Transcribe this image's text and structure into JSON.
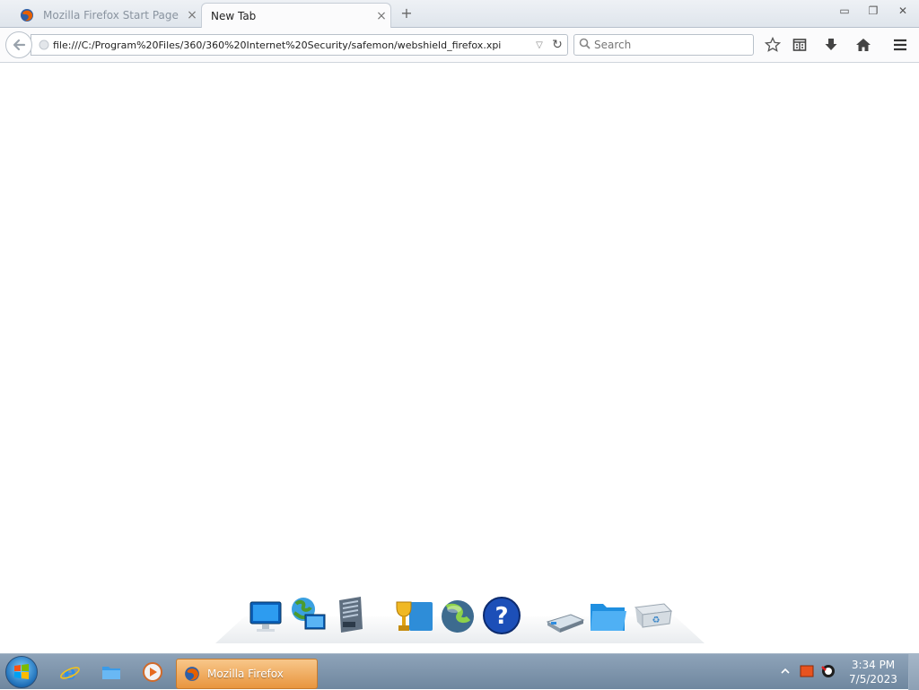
{
  "browser": {
    "tabs": [
      {
        "label": "Mozilla Firefox Start Page",
        "active": false
      },
      {
        "label": "New Tab",
        "active": true
      }
    ],
    "newtab_glyph": "+",
    "close_glyph": "×",
    "window_controls": {
      "minimize": "▭",
      "restore": "❐",
      "close": "✕"
    },
    "url": "file:///C:/Program%20Files/360/360%20Internet%20Security/safemon/webshield_firefox.xpi",
    "search_placeholder": "Search"
  },
  "taskbar": {
    "task_label": "Mozilla Firefox",
    "clock_time": "3:34 PM",
    "clock_date": "7/5/2023"
  },
  "icons": {
    "tab0": "firefox-icon",
    "nav": [
      "back-arrow-icon",
      "url-dropmarker-icon",
      "reload-icon",
      "search-icon",
      "bookmark-star-icon",
      "reading-list-icon",
      "download-icon",
      "home-icon",
      "menu-icon"
    ],
    "dock": [
      "monitor-icon",
      "network-globe-icon",
      "server-icon",
      "trophy-folder-icon",
      "globe-orb-icon",
      "help-icon",
      "drive-icon",
      "folder-icon",
      "recycle-bin-icon"
    ],
    "taskbar": [
      "start-orb-icon",
      "internet-explorer-icon",
      "file-explorer-icon",
      "media-player-icon",
      "firefox-icon"
    ],
    "tray": [
      "tray-chevron-icon",
      "tray-app-icon",
      "tray-security-icon"
    ]
  },
  "colors": {
    "taskbar": "#7a91a8",
    "active_task": "#e8953e",
    "accent_orange": "#e66000"
  }
}
